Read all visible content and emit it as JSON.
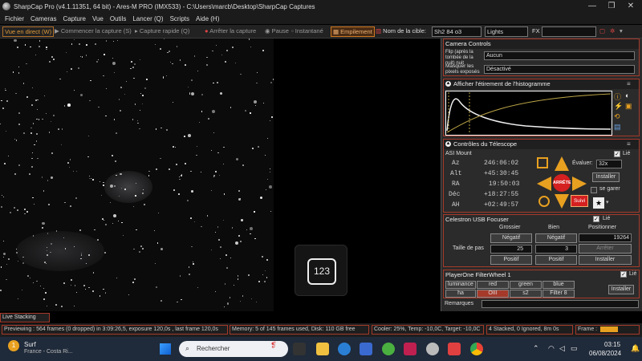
{
  "window": {
    "title": "SharpCap Pro (v4.1.11351, 64 bit) - Ares-M PRO (IMX533) - C:\\Users\\marcb\\Desktop\\SharpCap Captures",
    "minimize": "—",
    "maximize": "❐",
    "close": "✕"
  },
  "menu": [
    "Fichier",
    "Cameras",
    "Capture",
    "Vue",
    "Outils",
    "Lancer (Q)",
    "Scripts",
    "Aide (H)"
  ],
  "toolbar": {
    "live_view": "Vue en direct (W)",
    "start_capture": "Commencer la capture (S)",
    "quick_capture": "Capture rapide (Q)",
    "stop_capture": "Arrêter la capture",
    "pause": "Pause",
    "snapshot": "Instantané",
    "stacking": "Empilement",
    "target_label": "Nom de la cible:",
    "target_value": "Sh2 84 o3",
    "frame_type": "Lights",
    "fx": "FX"
  },
  "camera_controls": {
    "title": "Camera Controls",
    "flip_label": "Flip (après la tombée de la nuit) nuit",
    "flip_value": "Aucun",
    "hide_label": "Masquer les pixels exposés",
    "hide_value": "Désactivé"
  },
  "histogram": {
    "title": "Afficher l'étirement de l'histogramme"
  },
  "telescope": {
    "title": "Contrôles du Télescope",
    "mount_name": "ASI Mount",
    "linked": "Lié",
    "rows": [
      {
        "label": "Az",
        "value": "246:06:02"
      },
      {
        "label": "Alt",
        "value": "+45:30:45"
      },
      {
        "label": "RA",
        "value": "19:50:03"
      },
      {
        "label": "Déc",
        "value": "+18:27:55"
      },
      {
        "label": "AH",
        "value": "+02:49:57"
      }
    ],
    "rate_label": "Évaluer:",
    "rate_value": "32x",
    "install": "Installer",
    "park": "se garer",
    "stop": "ARRÊTE",
    "track": "Suivi"
  },
  "focuser": {
    "title": "Celestron USB Focuser",
    "linked": "Lié",
    "col_coarse": "Grossier",
    "col_fine": "Bien",
    "col_position": "Positionner",
    "negative": "Négatif",
    "positive": "Positif",
    "position_value": "19264",
    "step_label": "Taille de pas",
    "coarse_step": "25",
    "fine_step": "3",
    "stop": "Arrêter",
    "install": "Installer"
  },
  "filterwheel": {
    "title": "PlayerOne FilterWheel 1",
    "linked": "Lié",
    "filters": [
      "luminance",
      "red",
      "green",
      "blue",
      "ha",
      "OIII",
      "s2",
      "Filter 8"
    ],
    "install": "Installer"
  },
  "remarks": "Remarques",
  "live_stacking": "Live Stacking",
  "status": {
    "preview": "Previewing : 564 frames (0 dropped) in 3:09:26,5, exposure 120,0s , last frame 120,0s",
    "memory": "Memory: 5 of 145 frames used, Disk: 110 GB free",
    "cooler": "Cooler: 25%, Temp: -10,0C, Target: -10,0C",
    "stacked": "4 Stacked, 0 Ignored, 8m 0s",
    "frame": "Frame :"
  },
  "badge_number": "123",
  "taskbar": {
    "weather_title": "Surf",
    "weather_sub": "France - Costa Ri...",
    "search": "Rechercher",
    "time": "03:15",
    "date": "06/08/2024"
  },
  "colors": {
    "accent_orange": "#e8a020",
    "border_red": "#a53a2a",
    "stop_red": "#d42020"
  }
}
